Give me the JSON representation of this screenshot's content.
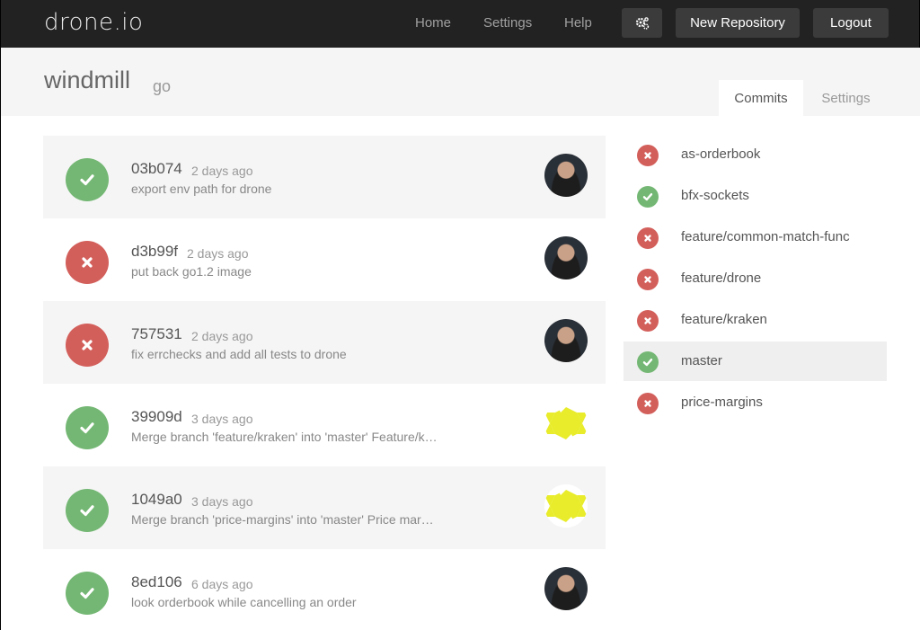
{
  "app": {
    "logo": "drone.io"
  },
  "nav": {
    "home": "Home",
    "settings": "Settings",
    "help": "Help",
    "new_repository": "New Repository",
    "logout": "Logout",
    "gear_icon": "gears-icon"
  },
  "repo": {
    "name": "windmill",
    "language": "go"
  },
  "tabs": [
    {
      "label": "Commits",
      "active": true
    },
    {
      "label": "Settings",
      "active": false
    }
  ],
  "colors": {
    "success": "#74b774",
    "failure": "#d35f5b",
    "topbar": "#222222",
    "identicon": "#e8ec2a"
  },
  "commits": [
    {
      "sha": "03b074",
      "ago": "2 days ago",
      "message": "export env path for drone",
      "status": "success",
      "avatar": "photo"
    },
    {
      "sha": "d3b99f",
      "ago": "2 days ago",
      "message": "put back go1.2 image",
      "status": "failure",
      "avatar": "photo"
    },
    {
      "sha": "757531",
      "ago": "2 days ago",
      "message": "fix errchecks and add all tests to drone",
      "status": "failure",
      "avatar": "photo"
    },
    {
      "sha": "39909d",
      "ago": "3 days ago",
      "message": "Merge branch 'feature/kraken' into 'master' Feature/k…",
      "status": "success",
      "avatar": "identicon"
    },
    {
      "sha": "1049a0",
      "ago": "3 days ago",
      "message": "Merge branch 'price-margins' into 'master' Price mar…",
      "status": "success",
      "avatar": "identicon"
    },
    {
      "sha": "8ed106",
      "ago": "6 days ago",
      "message": "look orderbook while cancelling an order",
      "status": "success",
      "avatar": "photo"
    }
  ],
  "branches": [
    {
      "name": "as-orderbook",
      "status": "failure",
      "active": false
    },
    {
      "name": "bfx-sockets",
      "status": "success",
      "active": false
    },
    {
      "name": "feature/common-match-func",
      "status": "failure",
      "active": false
    },
    {
      "name": "feature/drone",
      "status": "failure",
      "active": false
    },
    {
      "name": "feature/kraken",
      "status": "failure",
      "active": false
    },
    {
      "name": "master",
      "status": "success",
      "active": true
    },
    {
      "name": "price-margins",
      "status": "failure",
      "active": false
    }
  ]
}
